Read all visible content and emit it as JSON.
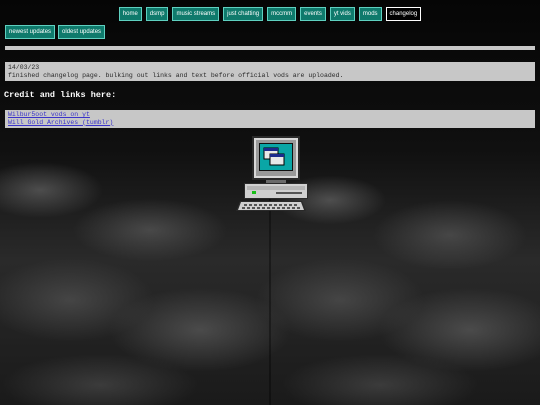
{
  "nav": {
    "items": [
      {
        "label": "home"
      },
      {
        "label": "dsmp"
      },
      {
        "label": "music streams"
      },
      {
        "label": "just chatting"
      },
      {
        "label": "mccmm"
      },
      {
        "label": "events"
      },
      {
        "label": "yt vids"
      },
      {
        "label": "mods"
      },
      {
        "label": "changelog",
        "active": true
      }
    ]
  },
  "subnav": {
    "newest": "newest updates",
    "oldest": "oldest updates"
  },
  "changelog": {
    "entries": [
      {
        "date": "14/03/23",
        "text": "finished changelog page. bulking out links and text before official vods are uploaded."
      }
    ]
  },
  "credits": {
    "heading": "Credit and links here:",
    "links": [
      {
        "label": "Wilbur5oot vods on yt"
      },
      {
        "label": "Will Gold Archives (tumblr)"
      }
    ]
  },
  "icons": {
    "computer": "retro-computer-icon"
  },
  "colors": {
    "nav_bg": "#0f7a6c",
    "nav_border": "#5fd0c0",
    "panel_bg": "#c7c7c7",
    "link": "#3a33c9"
  }
}
